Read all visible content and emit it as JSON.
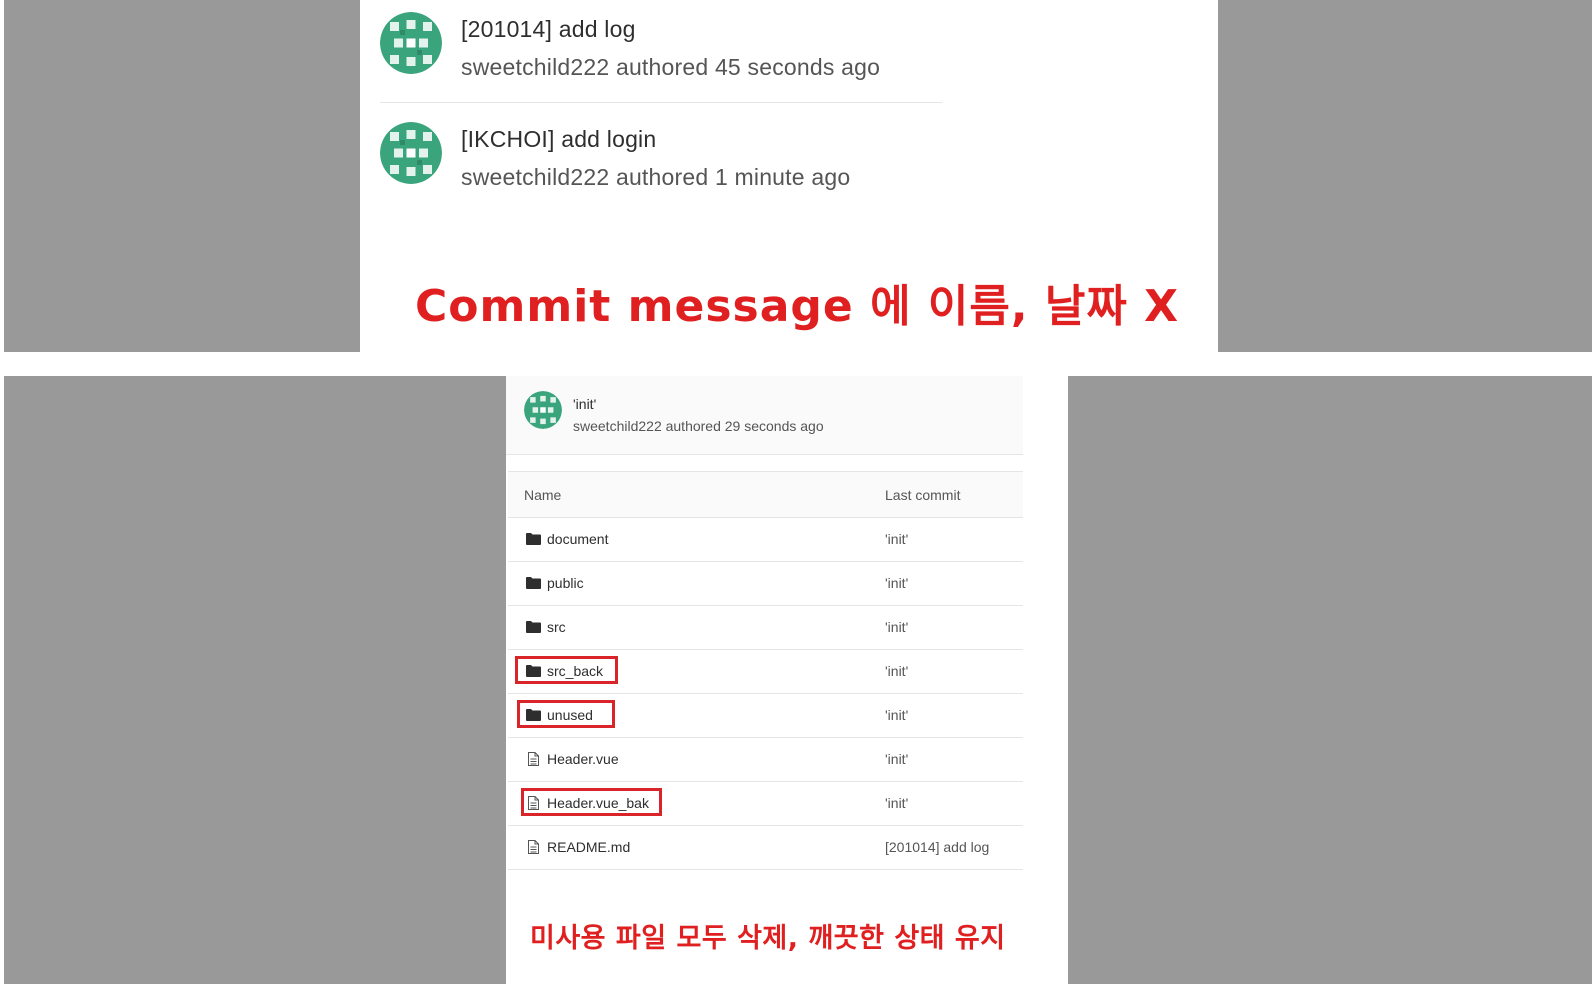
{
  "top_panel": {
    "commits": [
      {
        "title": "[201014] add log",
        "meta": "sweetchild222 authored 45 seconds ago"
      },
      {
        "title": "[IKCHOI] add login",
        "meta": "sweetchild222 authored 1 minute ago"
      }
    ],
    "callout": "Commit message 에 이름, 날짜 X"
  },
  "bottom_panel": {
    "last_commit": {
      "title": "'init'",
      "meta": "sweetchild222 authored 29 seconds ago"
    },
    "table": {
      "headers": {
        "name": "Name",
        "last_commit": "Last commit"
      },
      "rows": [
        {
          "name": "document",
          "type": "folder",
          "last_commit": "'init'",
          "highlighted": false
        },
        {
          "name": "public",
          "type": "folder",
          "last_commit": "'init'",
          "highlighted": false
        },
        {
          "name": "src",
          "type": "folder",
          "last_commit": "'init'",
          "highlighted": false
        },
        {
          "name": "src_back",
          "type": "folder",
          "last_commit": "'init'",
          "highlighted": true
        },
        {
          "name": "unused",
          "type": "folder",
          "last_commit": "'init'",
          "highlighted": true
        },
        {
          "name": "Header.vue",
          "type": "file",
          "last_commit": "'init'",
          "highlighted": false
        },
        {
          "name": "Header.vue_bak",
          "type": "file",
          "last_commit": "'init'",
          "highlighted": true
        },
        {
          "name": "README.md",
          "type": "file",
          "last_commit": "[201014] add log",
          "highlighted": false
        }
      ]
    },
    "callout": "미사용 파일 모두 삭제, 깨끗한 상태 유지"
  },
  "colors": {
    "background_gray": "#999999",
    "annotation_red": "#e02020",
    "highlight_box": "#d9242a",
    "avatar_green": "#3aa57d"
  },
  "icons": {
    "folder": "folder-icon",
    "file": "file-icon"
  }
}
